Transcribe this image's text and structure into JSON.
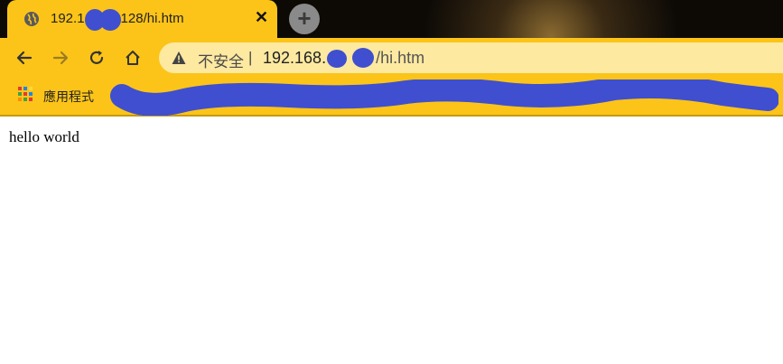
{
  "tab": {
    "title_start": "192.1",
    "title_end": "128/hi.htm",
    "close_glyph": "✕"
  },
  "new_tab_glyph": "+",
  "toolbar": {
    "back_icon": "arrow-left-icon",
    "forward_icon": "arrow-right-icon",
    "reload_icon": "reload-icon",
    "home_icon": "home-icon"
  },
  "omnibox": {
    "security_label": "不安全",
    "separator": "|",
    "url_host_start": "192.168.",
    "url_path": "/hi.htm"
  },
  "bookmarks": {
    "apps_label": "應用程式"
  },
  "page": {
    "text": "hello world"
  },
  "colors": {
    "toolbar": "#fcc419",
    "omnibox": "#fde9a0",
    "redaction": "#3f4fcf"
  }
}
